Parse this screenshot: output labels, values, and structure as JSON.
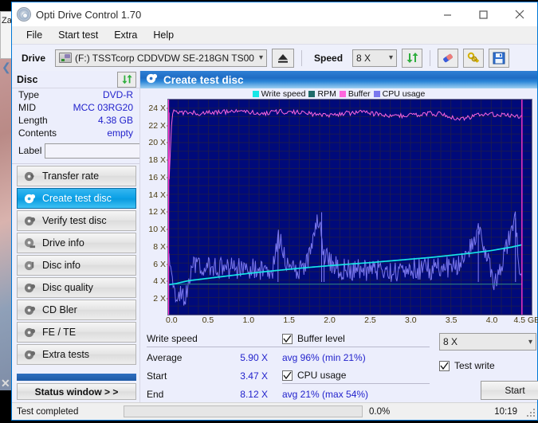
{
  "background": {
    "window_title_partial": "Zapisywanie jako"
  },
  "window": {
    "title": "Opti Drive Control 1.70",
    "app_icon": "disc-icon",
    "buttons": {
      "minimize": "minimize-icon",
      "maximize": "maximize-icon",
      "close": "close-icon"
    }
  },
  "menu": {
    "items": [
      "File",
      "Start test",
      "Extra",
      "Help"
    ]
  },
  "toolbar": {
    "drive_label": "Drive",
    "drive_value": "(F:)  TSSTcorp CDDVDW SE-218GN TS00",
    "eject_icon": "eject-icon",
    "speed_label": "Speed",
    "speed_value": "8 X",
    "refresh_icon": "refresh-icon",
    "erase_icon": "eraser-icon",
    "bypass_icon": "keys-icon",
    "save_icon": "save-icon"
  },
  "disc_panel": {
    "heading": "Disc",
    "refresh_icon": "refresh-icon",
    "rows": [
      {
        "key": "Type",
        "value": "DVD-R"
      },
      {
        "key": "MID",
        "value": "MCC 03RG20"
      },
      {
        "key": "Length",
        "value": "4.38 GB"
      },
      {
        "key": "Contents",
        "value": "empty"
      }
    ],
    "label_key": "Label",
    "label_value": "",
    "label_placeholder": "",
    "label_disc_icon": "disc-icon"
  },
  "nav": {
    "items": [
      {
        "label": "Transfer rate",
        "icon": "disc-bolt-icon",
        "active": false
      },
      {
        "label": "Create test disc",
        "icon": "disc-write-icon",
        "active": true
      },
      {
        "label": "Verify test disc",
        "icon": "disc-check-icon",
        "active": false
      },
      {
        "label": "Drive info",
        "icon": "disc-drive-icon",
        "active": false
      },
      {
        "label": "Disc info",
        "icon": "disc-info-icon",
        "active": false
      },
      {
        "label": "Disc quality",
        "icon": "disc-quality-icon",
        "active": false
      },
      {
        "label": "CD Bler",
        "icon": "disc-bler-icon",
        "active": false
      },
      {
        "label": "FE / TE",
        "icon": "disc-fete-icon",
        "active": false
      },
      {
        "label": "Extra tests",
        "icon": "disc-extra-icon",
        "active": false
      }
    ],
    "status_window_button": "Status window > >"
  },
  "content": {
    "heading": "Create test disc",
    "heading_icon": "disc-write-icon"
  },
  "chart_data": {
    "type": "line",
    "title": "Create test disc",
    "xlabel": "GB",
    "ylabel": "X",
    "xlim": [
      0.0,
      4.5
    ],
    "ylim": [
      0,
      25
    ],
    "grid": true,
    "legend_position": "top",
    "xticks": [
      "0.0",
      "0.5",
      "1.0",
      "1.5",
      "2.0",
      "2.5",
      "3.0",
      "3.5",
      "4.0",
      "4.5 GB"
    ],
    "xtick_values": [
      0.0,
      0.5,
      1.0,
      1.5,
      2.0,
      2.5,
      3.0,
      3.5,
      4.0,
      4.5
    ],
    "yticks": [
      "2 X",
      "4 X",
      "6 X",
      "8 X",
      "10 X",
      "12 X",
      "14 X",
      "16 X",
      "18 X",
      "20 X",
      "22 X",
      "24 X"
    ],
    "ytick_values": [
      2,
      4,
      6,
      8,
      10,
      12,
      14,
      16,
      18,
      20,
      22,
      24
    ],
    "colors": {
      "write_speed": "#16e6e6",
      "rpm": "#1f6b6b",
      "buffer": "#ff66dd",
      "cpu_usage": "#7b78ee",
      "plot_background": "#000a7a",
      "grid": "#1b1b4e",
      "end_marker": "#ff33cc"
    },
    "series": [
      {
        "name": "Write speed",
        "color": "#16e6e6",
        "x": [
          0.0,
          0.1,
          0.25,
          0.5,
          0.75,
          1.0,
          1.25,
          1.5,
          1.75,
          2.0,
          2.25,
          2.5,
          2.75,
          3.0,
          3.25,
          3.5,
          3.75,
          4.0,
          4.25,
          4.38
        ],
        "values": [
          3.47,
          3.62,
          3.95,
          4.23,
          4.52,
          4.8,
          5.05,
          5.28,
          5.5,
          5.7,
          5.88,
          6.05,
          6.25,
          6.45,
          6.65,
          6.9,
          7.15,
          7.45,
          7.85,
          8.12
        ]
      },
      {
        "name": "RPM",
        "color": "#1f6b6b",
        "x": [
          0.0,
          0.5,
          1.0,
          1.5,
          2.0,
          2.5,
          3.0,
          3.5,
          4.0,
          4.38
        ],
        "values": [
          3.55,
          3.55,
          3.55,
          3.55,
          3.55,
          3.55,
          3.55,
          3.55,
          3.55,
          3.55
        ]
      },
      {
        "name": "Buffer",
        "color": "#ff66dd",
        "x": [
          0.0,
          0.05,
          0.2,
          0.4,
          0.6,
          0.8,
          1.0,
          1.2,
          1.4,
          1.6,
          1.8,
          2.0,
          2.2,
          2.4,
          2.6,
          2.8,
          3.0,
          3.2,
          3.4,
          3.6,
          3.8,
          4.0,
          4.2,
          4.38
        ],
        "values": [
          13.5,
          23.6,
          23.5,
          23.4,
          23.5,
          23.6,
          23.5,
          23.4,
          23.6,
          23.5,
          23.3,
          23.2,
          23.4,
          23.5,
          23.3,
          23.1,
          23.2,
          23.4,
          23.3,
          22.7,
          23.1,
          23.3,
          23.2,
          23.0
        ]
      },
      {
        "name": "CPU usage",
        "color": "#7b78ee",
        "x": [
          0.0,
          0.1,
          0.2,
          0.3,
          0.5,
          0.7,
          0.9,
          1.1,
          1.3,
          1.36,
          1.5,
          1.7,
          1.88,
          1.92,
          2.1,
          2.4,
          2.7,
          3.0,
          3.3,
          3.6,
          3.84,
          4.05,
          4.3,
          4.36
        ],
        "values": [
          8.0,
          2.2,
          1.6,
          5.9,
          5.6,
          5.4,
          5.3,
          5.2,
          5.4,
          9.3,
          5.0,
          5.5,
          11.8,
          7.2,
          5.3,
          5.2,
          5.0,
          5.4,
          5.3,
          5.6,
          9.6,
          3.6,
          11.0,
          4.5
        ]
      }
    ],
    "legend": [
      {
        "label": "Write speed",
        "color": "#16e6e6"
      },
      {
        "label": "RPM",
        "color": "#1f6b6b"
      },
      {
        "label": "Buffer",
        "color": "#ff66dd"
      },
      {
        "label": "CPU usage",
        "color": "#7b78ee"
      }
    ]
  },
  "results": {
    "write_speed_heading": "Write speed",
    "rows": [
      {
        "key": "Average",
        "value": "5.90 X"
      },
      {
        "key": "Start",
        "value": "3.47 X"
      },
      {
        "key": "End",
        "value": "8.12 X"
      }
    ],
    "buffer_level_label": "Buffer level",
    "buffer_level_checked": true,
    "buffer_level_value": "avg 96% (min 21%)",
    "cpu_usage_label": "CPU usage",
    "cpu_usage_checked": true,
    "cpu_usage_value": "avg 21% (max 54%)",
    "speed_value": "8 X",
    "test_write_label": "Test write",
    "test_write_checked": true,
    "start_button": "Start"
  },
  "statusbar": {
    "text": "Test completed",
    "progress_percent": "0.0%",
    "progress_value": 0,
    "clock": "10:19"
  }
}
